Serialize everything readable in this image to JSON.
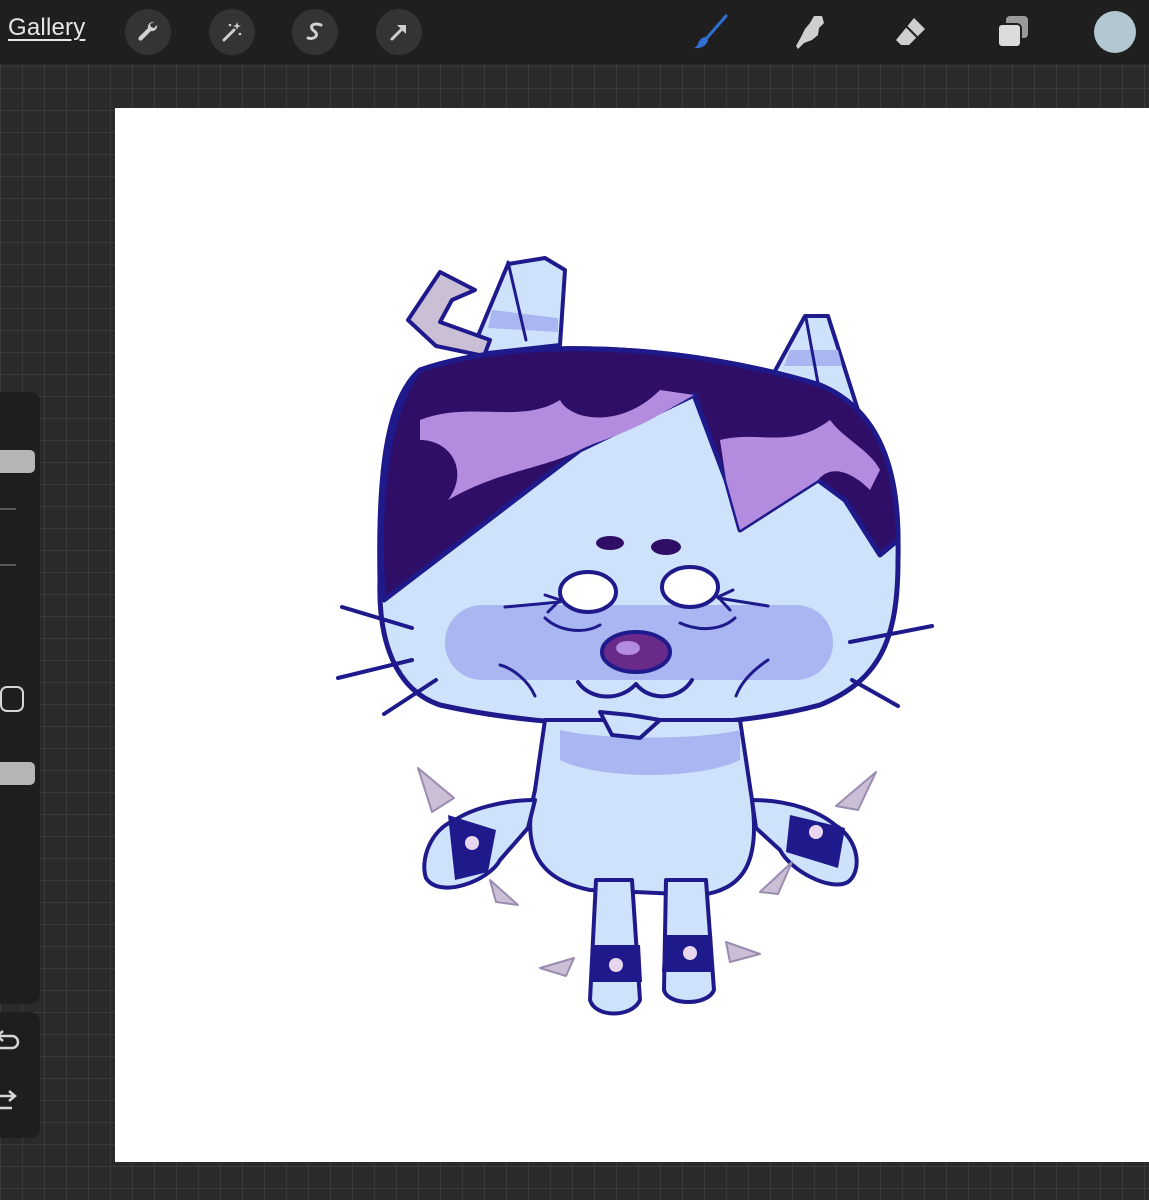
{
  "topbar": {
    "gallery_label": "Gallery",
    "actions": [
      {
        "icon": "wrench-icon"
      },
      {
        "icon": "magic-wand-icon"
      },
      {
        "icon": "selection-icon"
      },
      {
        "icon": "transform-arrow-icon"
      }
    ],
    "tools": [
      {
        "icon": "brush-icon",
        "active": true
      },
      {
        "icon": "smudge-icon",
        "active": false
      },
      {
        "icon": "eraser-icon",
        "active": false
      },
      {
        "icon": "layers-icon",
        "active": false
      }
    ],
    "current_color": "#b3c7d3"
  },
  "sidebar": {
    "brush_size_level": 0.1,
    "opacity_level": 0.4
  },
  "colors": {
    "accent": "#2f6fd4",
    "canvas": "#ffffff",
    "outline": "#1f1a8c",
    "body_fill": "#cfe2fb",
    "shade": "#aab6f2",
    "hair": "#2e0e66",
    "hair_stripe": "#b38ce0",
    "nose": "#6a2a8a",
    "accessory": "#cbbfd6"
  }
}
